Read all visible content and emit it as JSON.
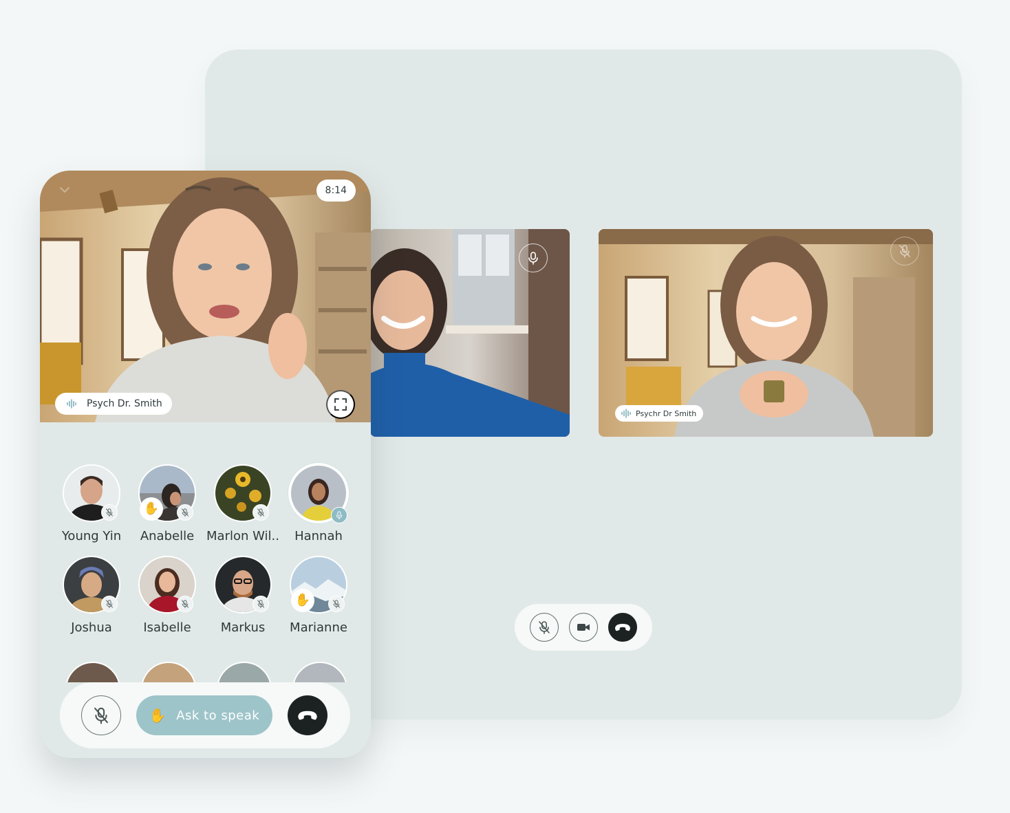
{
  "desktop": {
    "tiles": [
      {
        "id": "guest",
        "mic_icon": "microphone-icon"
      },
      {
        "id": "host",
        "label": "Psychr Dr Smith",
        "mic_icon": "microphone-muted-icon"
      }
    ],
    "controls": [
      {
        "name": "mute",
        "icon": "microphone-muted-icon"
      },
      {
        "name": "camera",
        "icon": "video-camera-icon"
      },
      {
        "name": "end-call",
        "icon": "phone-hangup-icon"
      }
    ]
  },
  "phone": {
    "timer": "8:14",
    "speaker_label": "Psych Dr. Smith",
    "participants": [
      {
        "name": "Young Yin",
        "muted": true,
        "hand_raised": false,
        "speaking": false
      },
      {
        "name": "Anabelle",
        "muted": true,
        "hand_raised": true,
        "speaking": false
      },
      {
        "name": "Marlon Wil..",
        "muted": true,
        "hand_raised": false,
        "speaking": false
      },
      {
        "name": "Hannah",
        "muted": false,
        "hand_raised": false,
        "speaking": true
      },
      {
        "name": "Joshua",
        "muted": true,
        "hand_raised": false,
        "speaking": false
      },
      {
        "name": "Isabelle",
        "muted": true,
        "hand_raised": false,
        "speaking": false
      },
      {
        "name": "Markus",
        "muted": true,
        "hand_raised": false,
        "speaking": false
      },
      {
        "name": "Marianne",
        "muted": true,
        "hand_raised": true,
        "speaking": false
      }
    ],
    "ask_to_speak_label": "Ask to speak"
  },
  "colors": {
    "panel": "#e1e9e8",
    "accent": "#9dc4c9",
    "end_call": "#1c2222"
  }
}
